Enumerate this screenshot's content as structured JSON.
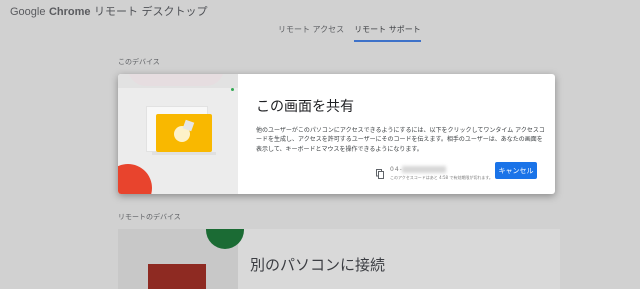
{
  "app": {
    "brand_google": "Google",
    "brand_chrome": "Chrome",
    "title_rest": "リモート デスクトップ"
  },
  "tabs": [
    {
      "label": "リモート アクセス",
      "active": false
    },
    {
      "label": "リモート サポート",
      "active": true
    }
  ],
  "sections": {
    "this_device": "このデバイス",
    "remote_devices": "リモートのデバイス"
  },
  "dialog": {
    "title": "この画面を共有",
    "body": "他のユーザーがこのパソコンにアクセスできるようにするには、以下をクリックしてワンタイム アクセスコードを生成し、アクセスを許可するユーザーにそのコードを伝えます。相手のユーザーは、あなたの画面を表示して、キーボードとマウスを操作できるようになります。",
    "code_prefix": "04-",
    "code_note": "このアクセスコードはあと 4:58 で有効期限が切れます。",
    "cancel_label": "キャンセル"
  },
  "background_card": {
    "title": "別のパソコンに接続"
  },
  "colors": {
    "accent": "#1a73e8",
    "tab_underline": "#3e72c9",
    "illustration_yellow": "#f9b800",
    "illustration_red": "#e8442d",
    "illustration_green": "#34a853"
  }
}
